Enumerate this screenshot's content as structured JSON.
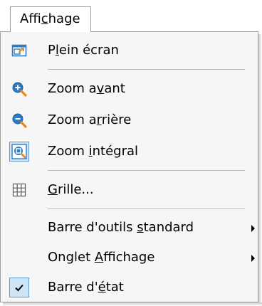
{
  "menubar": {
    "title_parts": [
      "Affi",
      "c",
      "hage"
    ]
  },
  "menu": {
    "fullscreen": {
      "pre": "P",
      "acc": "l",
      "post": "ein écran",
      "icon": "fullscreen-icon"
    },
    "zoom_in": {
      "pre": "Zoom a",
      "acc": "v",
      "post": "ant",
      "icon": "zoom-in-icon"
    },
    "zoom_out": {
      "pre": "Zoom a",
      "acc": "r",
      "post": "rière",
      "icon": "zoom-out-icon"
    },
    "zoom_fit": {
      "pre": "Zoom ",
      "acc": "i",
      "post": "ntégral",
      "icon": "zoom-fit-icon",
      "checked": true
    },
    "grid": {
      "pre": "",
      "acc": "G",
      "post": "rille...",
      "icon": "grid-icon"
    },
    "toolbar": {
      "pre": "Barre d'outils ",
      "acc": "s",
      "post": "tandard",
      "submenu": true
    },
    "view_tab": {
      "pre": "Onglet ",
      "acc": "A",
      "post": "ffichage",
      "submenu": true
    },
    "statusbar": {
      "pre": "Barre d'",
      "acc": "é",
      "post": "tat",
      "icon": "checkmark-icon",
      "checked": true
    }
  },
  "colors": {
    "menu_bg": "#f6f6f6",
    "border": "#9e9e9e",
    "separator": "#b8b8b8",
    "checked_bg": "#cfe4f7",
    "checked_border": "#5d9bd8",
    "icon_blue": "#2e7bc4",
    "icon_orange": "#e8871e"
  }
}
